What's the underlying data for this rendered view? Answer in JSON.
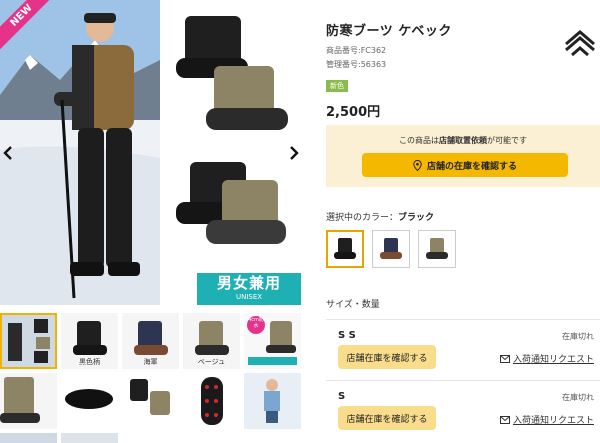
{
  "gallery": {
    "new_badge": "NEW",
    "unisex_big": "男女兼用",
    "unisex_small": "UNISEX",
    "thumbs_row1": [
      {
        "label": ""
      },
      {
        "label": "黒色柄"
      },
      {
        "label": "海軍"
      },
      {
        "label": "ベージュ"
      },
      {
        "label": ""
      }
    ],
    "thumb_promo": {
      "badge": "4cm防水"
    }
  },
  "product": {
    "title": "防寒ブーツ ケベック",
    "item_number": "商品番号:FC362",
    "control_number": "管理番号:56363",
    "new_tag": "新色",
    "price": "2,500円"
  },
  "pickup": {
    "text_pre": "この商品は",
    "text_bold": "店舗取置依頼",
    "text_post": "が可能です",
    "button_label": "店舗の在庫を確認する"
  },
  "color": {
    "label_prefix": "選択中のカラー：",
    "selected": "ブラック"
  },
  "sizes": {
    "section_label": "サイズ・数量",
    "rows": [
      {
        "name": "S S",
        "status": "在庫切れ",
        "store_button": "店舗在庫を確認する",
        "notify": "入荷通知リクエスト"
      },
      {
        "name": "S",
        "status": "在庫切れ",
        "store_button": "店舗在庫を確認する",
        "notify": "入荷通知リクエスト"
      }
    ]
  },
  "colors_theme": {
    "accent": "#f5b800",
    "pickup_bg": "#fbf0d4",
    "new_pink": "#e6338a",
    "unisex_teal": "#1fb0b3"
  }
}
